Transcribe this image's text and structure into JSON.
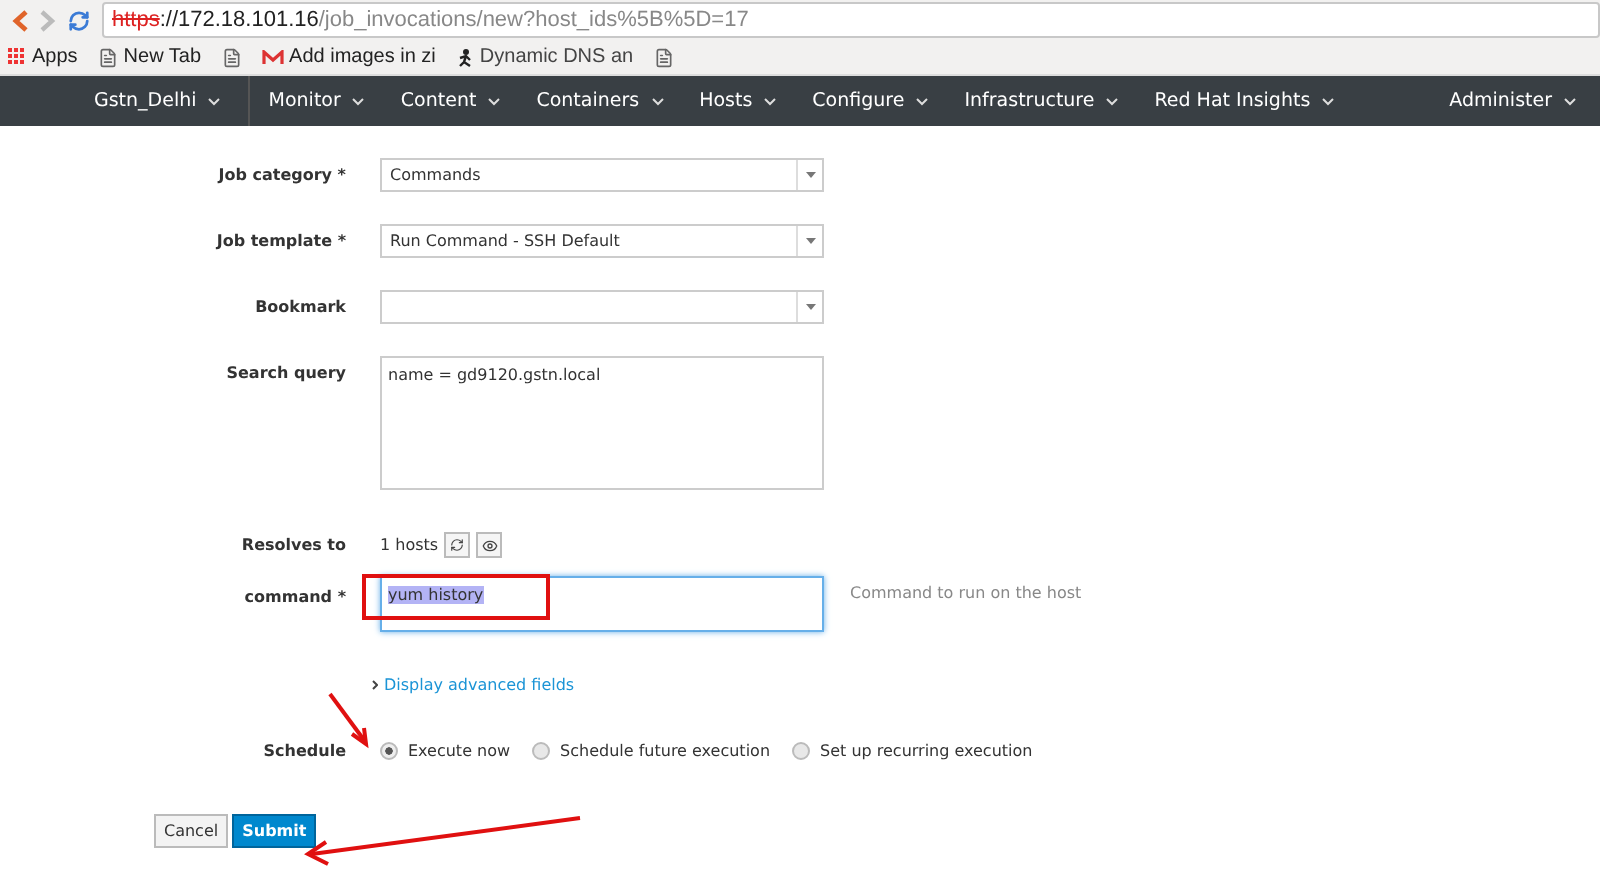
{
  "browser": {
    "url": {
      "scheme": "https",
      "host": "://172.18.101.16",
      "path": "/job_invocations/new?host_ids%5B%5D=17"
    },
    "bookmarks": [
      {
        "kind": "apps",
        "label": "Apps"
      },
      {
        "kind": "page",
        "label": "New Tab"
      },
      {
        "kind": "blank"
      },
      {
        "kind": "mail",
        "label": "Add images in zi"
      },
      {
        "kind": "runner",
        "label": "Dynamic DNS an"
      },
      {
        "kind": "blank"
      }
    ]
  },
  "nav": {
    "organization": "Gstn_Delhi",
    "menus": [
      "Monitor",
      "Content",
      "Containers",
      "Hosts",
      "Configure",
      "Infrastructure",
      "Red Hat Insights"
    ],
    "user_menu": "Administer"
  },
  "form": {
    "fields": [
      {
        "kind": "select",
        "label": "Job category *",
        "value": "Commands"
      },
      {
        "kind": "select",
        "label": "Job template *",
        "value": "Run Command - SSH Default"
      },
      {
        "kind": "select",
        "label": "Bookmark"
      },
      {
        "kind": "textarea",
        "label": "Search query",
        "value": "name = gd9120.gstn.local"
      }
    ],
    "resolves": {
      "label": "Resolves to",
      "count": "1 hosts"
    },
    "command": {
      "label": "command *",
      "value": "yum history",
      "selected": true,
      "help": "Command to run on the host"
    },
    "advanced_link": "Display advanced fields",
    "schedule": {
      "label": "Schedule",
      "options": [
        {
          "label": "Execute now",
          "selected": true
        },
        {
          "label": "Schedule future execution",
          "selected": false
        },
        {
          "label": "Set up recurring execution",
          "selected": false
        }
      ]
    },
    "buttons": [
      {
        "kind": "default",
        "label": "Cancel"
      },
      {
        "kind": "primary",
        "label": "Submit"
      }
    ]
  }
}
